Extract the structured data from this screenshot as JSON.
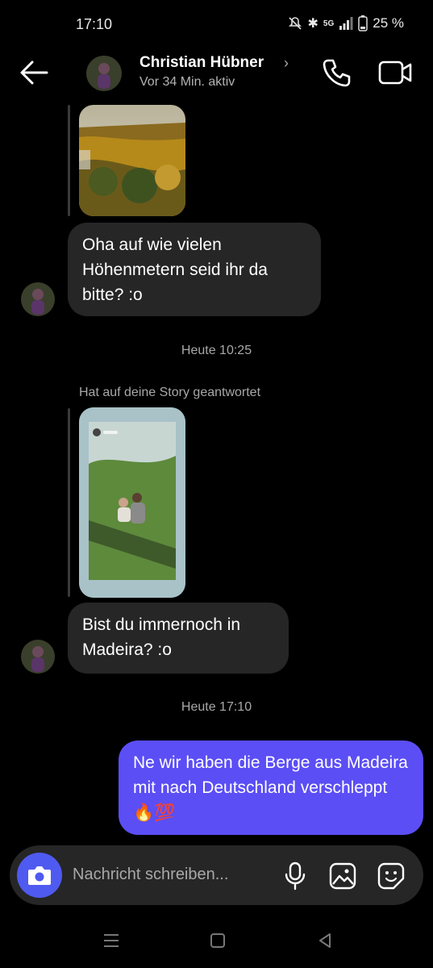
{
  "status": {
    "time": "17:10",
    "network": "5G",
    "battery": "25 %"
  },
  "header": {
    "name": "Christian Hübner",
    "subtitle": "Vor 34 Min. aktiv"
  },
  "messages": {
    "first_in": "Oha auf wie vielen Höhenmetern seid ihr da bitte? :o",
    "stamp1": "Heute 10:25",
    "story_reply_label": "Hat auf deine Story geantwortet",
    "second_in": "Bist du immernoch in Madeira? :o",
    "stamp2": "Heute 17:10",
    "out_text": "Ne wir haben die Berge aus Madeira mit nach Deutschland verschleppt",
    "out_emoji": "🔥💯"
  },
  "composer": {
    "placeholder": "Nachricht schreiben..."
  },
  "colors": {
    "accent": "#5b4ef5",
    "bubble_in": "#262626",
    "camera": "#4f5af0"
  }
}
